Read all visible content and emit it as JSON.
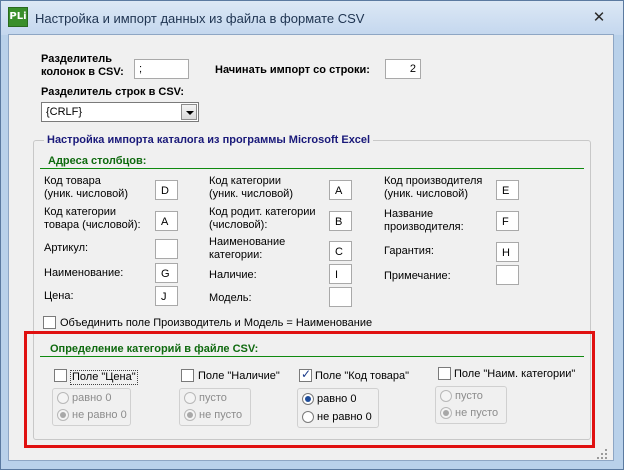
{
  "window": {
    "title": "Настройка и импорт данных из файла в формате CSV",
    "icon_text": "PLi",
    "close_glyph": "✕"
  },
  "top": {
    "col_sep_label_1": "Разделитель",
    "col_sep_label_2": "колонок в CSV:",
    "col_sep_value": ";",
    "start_row_label": "Начинать импорт со строки:",
    "start_row_value": "2",
    "row_sep_label": "Разделитель строк в CSV:",
    "row_sep_value": "{CRLF}"
  },
  "excel_group": {
    "title": "Настройка импорта каталога из программы Microsoft Excel",
    "columns_title": "Адреса столбцов:",
    "fields": [
      {
        "l1": "Код товара",
        "l2": "(уник. числовой)",
        "value": "D"
      },
      {
        "l1": "Код категории",
        "l2": "товара (числовой):",
        "value": "A"
      },
      {
        "l1": "Артикул:",
        "l2": "",
        "value": ""
      },
      {
        "l1": "Наименование:",
        "l2": "",
        "value": "G"
      },
      {
        "l1": "Цена:",
        "l2": "",
        "value": "J"
      },
      {
        "l1": "Код категории",
        "l2": "(уник. числовой)",
        "value": "A"
      },
      {
        "l1": "Код родит. категории",
        "l2": "(числовой):",
        "value": "B"
      },
      {
        "l1": "Наименование",
        "l2": "категории:",
        "value": "C"
      },
      {
        "l1": "Наличие:",
        "l2": "",
        "value": "I"
      },
      {
        "l1": "Модель:",
        "l2": "",
        "value": ""
      },
      {
        "l1": "Код производителя",
        "l2": "(уник. числовой)",
        "value": "E"
      },
      {
        "l1": "Название",
        "l2": "производителя:",
        "value": "F"
      },
      {
        "l1": "Гарантия:",
        "l2": "",
        "value": "H"
      },
      {
        "l1": "Примечание:",
        "l2": "",
        "value": ""
      }
    ],
    "merge_label": "Объединить поле Производитель и Модель = Наименование",
    "merge_checked": false
  },
  "categories": {
    "title": "Определение категорий в файле CSV:",
    "groups": [
      {
        "label": "Поле \"Цена\"",
        "checked": false,
        "opt1": "равно 0",
        "opt2": "не равно 0",
        "enabled": false,
        "selected": 1
      },
      {
        "label": "Поле \"Наличие\"",
        "checked": false,
        "opt1": "пусто",
        "opt2": "не пусто",
        "enabled": false,
        "selected": 2
      },
      {
        "label": "Поле \"Код товара\"",
        "checked": true,
        "opt1": "равно 0",
        "opt2": "не равно 0",
        "enabled": true,
        "selected": 1
      },
      {
        "label": "Поле \"Наим. категории\"",
        "checked": false,
        "opt1": "пусто",
        "opt2": "не пусто",
        "enabled": false,
        "selected": 2
      }
    ]
  },
  "colors": {
    "highlight": "#e01010",
    "section_green": "#0f6a0f",
    "group_title_blue": "#1a1a7a"
  }
}
